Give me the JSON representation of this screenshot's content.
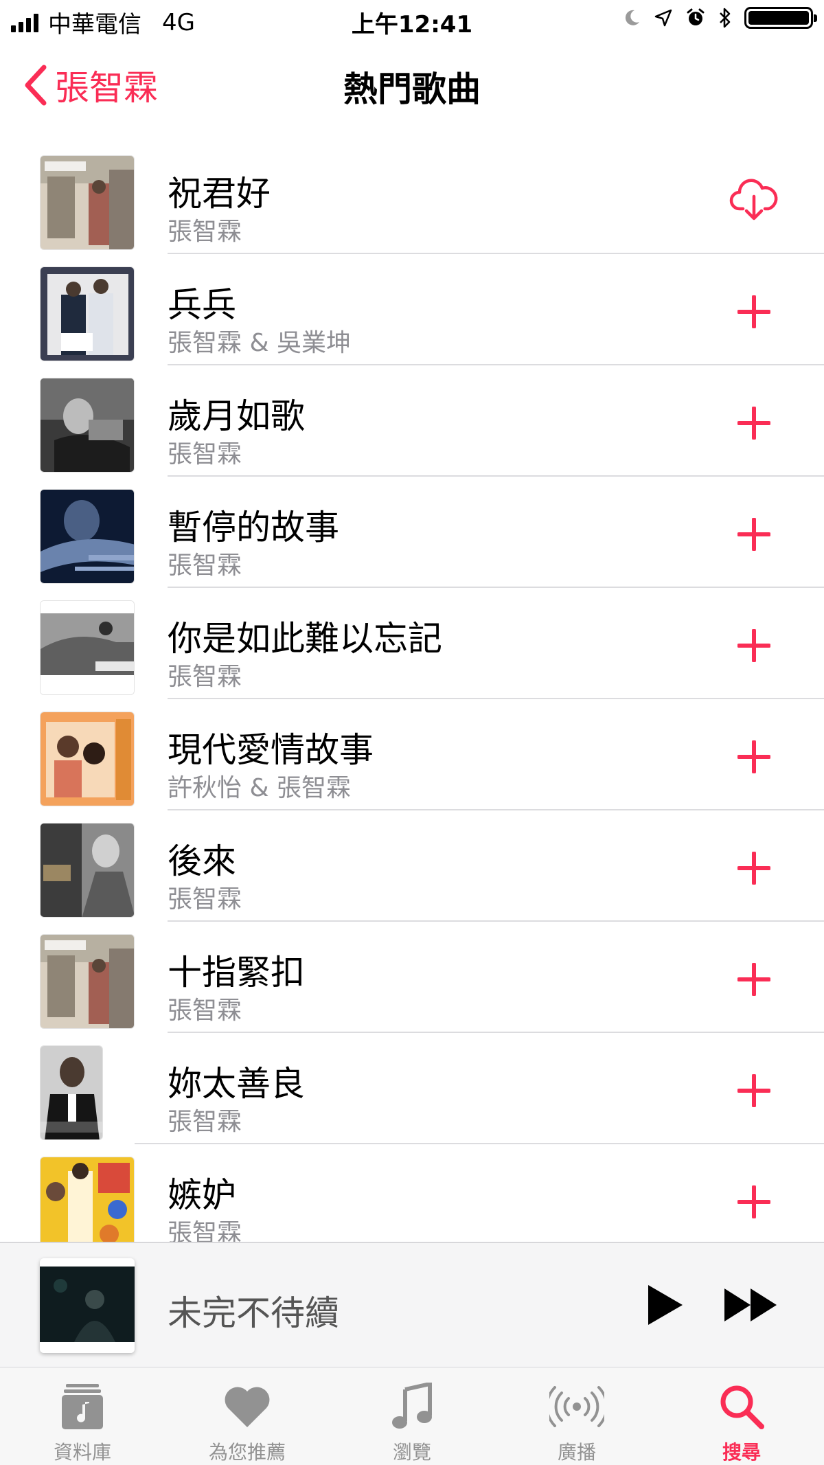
{
  "status_bar": {
    "carrier": "中華電信",
    "network": "4G",
    "time": "上午12:41"
  },
  "nav": {
    "back_label": "張智霖",
    "title": "熱門歌曲"
  },
  "colors": {
    "accent": "#fa2d55",
    "secondary_text": "#8e8e93"
  },
  "songs": [
    {
      "title": "祝君好",
      "artist": "張智霖",
      "action": "download-icon"
    },
    {
      "title": "兵兵",
      "artist": "張智霖 & 吳業坤",
      "action": "add-icon"
    },
    {
      "title": "歲月如歌",
      "artist": "張智霖",
      "action": "add-icon"
    },
    {
      "title": "暫停的故事",
      "artist": "張智霖",
      "action": "add-icon"
    },
    {
      "title": "你是如此難以忘記",
      "artist": "張智霖",
      "action": "add-icon"
    },
    {
      "title": "現代愛情故事",
      "artist": "許秋怡 & 張智霖",
      "action": "add-icon"
    },
    {
      "title": "後來",
      "artist": "張智霖",
      "action": "add-icon"
    },
    {
      "title": "十指緊扣",
      "artist": "張智霖",
      "action": "add-icon"
    },
    {
      "title": "妳太善良",
      "artist": "張智霖",
      "action": "add-icon"
    },
    {
      "title": "嫉妒",
      "artist": "張智霖",
      "action": "add-icon"
    }
  ],
  "now_playing": {
    "title": "未完不待續"
  },
  "tabs": [
    {
      "label": "資料庫",
      "icon": "library-icon",
      "active": false
    },
    {
      "label": "為您推薦",
      "icon": "heart-icon",
      "active": false
    },
    {
      "label": "瀏覽",
      "icon": "music-note-icon",
      "active": false
    },
    {
      "label": "廣播",
      "icon": "radio-icon",
      "active": false
    },
    {
      "label": "搜尋",
      "icon": "search-icon",
      "active": true
    }
  ]
}
